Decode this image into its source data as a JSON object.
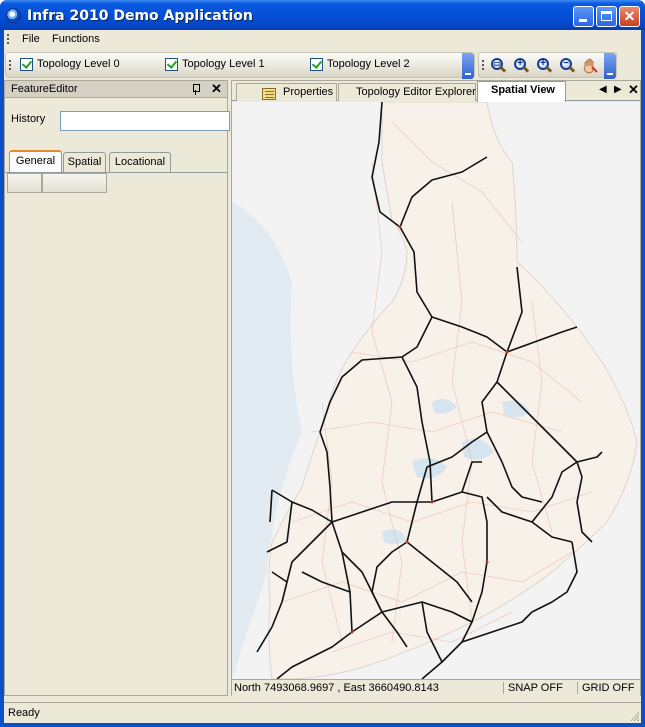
{
  "window": {
    "title": "Infra 2010 Demo Application"
  },
  "menu": {
    "items": [
      "File",
      "Functions"
    ]
  },
  "toolbar": {
    "layers": [
      {
        "label": "Topology Level 0",
        "checked": true
      },
      {
        "label": "Topology Level 1",
        "checked": true
      },
      {
        "label": "Topology Level 2",
        "checked": true
      }
    ],
    "tools": [
      "zoom-extent-icon",
      "zoom-in-icon",
      "zoom-in-plus-icon",
      "zoom-out-icon",
      "pan-hand-icon"
    ]
  },
  "feature_editor": {
    "title": "FeatureEditor",
    "history_label": "History",
    "history_value": "",
    "tabs": [
      "General",
      "Spatial",
      "Locational"
    ],
    "active_tab": "General"
  },
  "documents": {
    "tabs": [
      "Properties",
      "Topology Editor Explorer",
      "Spatial View"
    ],
    "active_tab": "Spatial View"
  },
  "map": {
    "coordinates": "North 7493068.9697 , East 3660490.8143",
    "snap": "SNAP OFF",
    "grid": "GRID OFF",
    "colors": {
      "land": "#f8f4ee",
      "water": "#dfeaf3",
      "rail": "#111111",
      "roads": "#e8b8a0"
    }
  },
  "status": {
    "text": "Ready"
  }
}
